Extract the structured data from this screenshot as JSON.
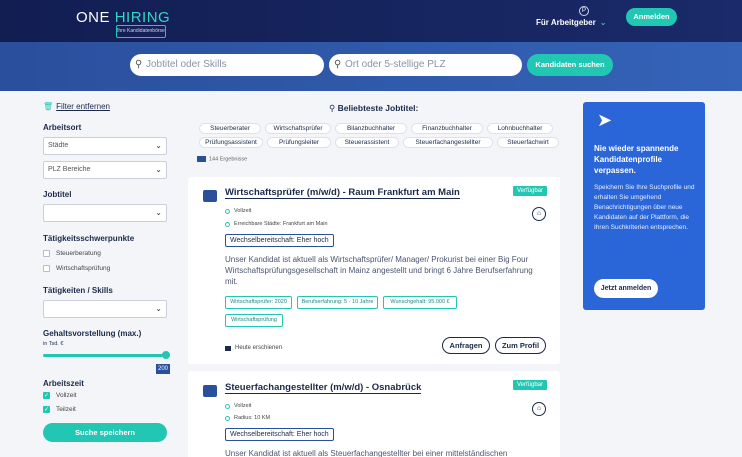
{
  "header": {
    "logo_a": "ONE ",
    "logo_b": "HIRING",
    "tagline": "Ihre Kandidatenbörse",
    "employer": "Für Arbeitgeber",
    "employer_chevron": "⌄",
    "login": "Anmelden"
  },
  "search": {
    "skills_placeholder": "Jobtitel oder Skills",
    "location_placeholder": "Ort oder 5-stellige PLZ",
    "button": "Kandidaten suchen"
  },
  "sidebar": {
    "remove_filter": "Filter entfernen",
    "arbeitsort": "Arbeitsort",
    "staedte": "Städte",
    "plz": "PLZ Bereiche",
    "jobtitel": "Jobtitel",
    "schwerpunkte": "Tätigkeitsschwerpunkte",
    "cb_steuer": "Steuerberatung",
    "cb_wirt": "Wirtschaftsprüfung",
    "taetigkeiten": "Tätigkeiten / Skills",
    "gehalt": "Gehaltsvorstellung (max.)",
    "gehalt_unit": "in Tsd. €",
    "slider_value": "200",
    "arbeitszeit": "Arbeitszeit",
    "vollzeit": "Vollzeit",
    "teilzeit": "Teilzeit",
    "save": "Suche speichern"
  },
  "popular": {
    "title": "Beliebteste Jobtitel:",
    "chips": [
      "Steuerberater",
      "Wirtschaftsprüfer",
      "Bilanzbuchhalter",
      "Finanzbuchhalter",
      "Lohnbuchhalter",
      "Prüfungsassistent",
      "Prüfungsleiter",
      "Steuerassistent",
      "Steuerfachangestellter",
      "Steuerfachwirt"
    ],
    "count": "144 Ergebnisse"
  },
  "cards": [
    {
      "title": "Wirtschaftsprüfer (m/w/d) - Raum Frankfurt am Main",
      "badge": "Verfügbar",
      "type": "Vollzeit",
      "location": "Erreichbare Städte: Frankfurt am Main",
      "willingness": "Wechselbereitschaft: Eher hoch",
      "desc": "Unser Kandidat ist aktuell als Wirtschaftsprüfer/ Manager/ Prokurist bei einer Big Four Wirtschaftsprüfungsgesellschaft in Mainz angestellt und bringt 6 Jahre Berufserfahrung mit.",
      "tags": [
        "Wirtschaftsprüfer: 2020",
        "Berufserfahrung: 5 - 10 Jahre",
        "Wunschgehalt: 95.000 €",
        "Wirtschaftsprüfung"
      ],
      "posted": "Heute erschienen",
      "btn_request": "Anfragen",
      "btn_profile": "Zum Profil"
    },
    {
      "title": "Steuerfachangestellter (m/w/d) - Osnabrück",
      "badge": "Verfügbar",
      "type": "Vollzeit",
      "location": "Radius: 10 KM",
      "willingness": "Wechselbereitschaft: Eher hoch",
      "desc": "Unser Kandidat ist aktuell als Steuerfachangestellter bei einer mittelständischen"
    }
  ],
  "promo": {
    "title": "Nie wieder spannende Kandidatenprofile verpassen.",
    "text": "Speichern Sie Ihre Suchprofile und erhalten Sie umgehend Benachrichtigungen über neue Kandidaten auf der Plattform, die Ihren Suchkriterien entsprechen.",
    "button": "Jetzt anmelden"
  }
}
